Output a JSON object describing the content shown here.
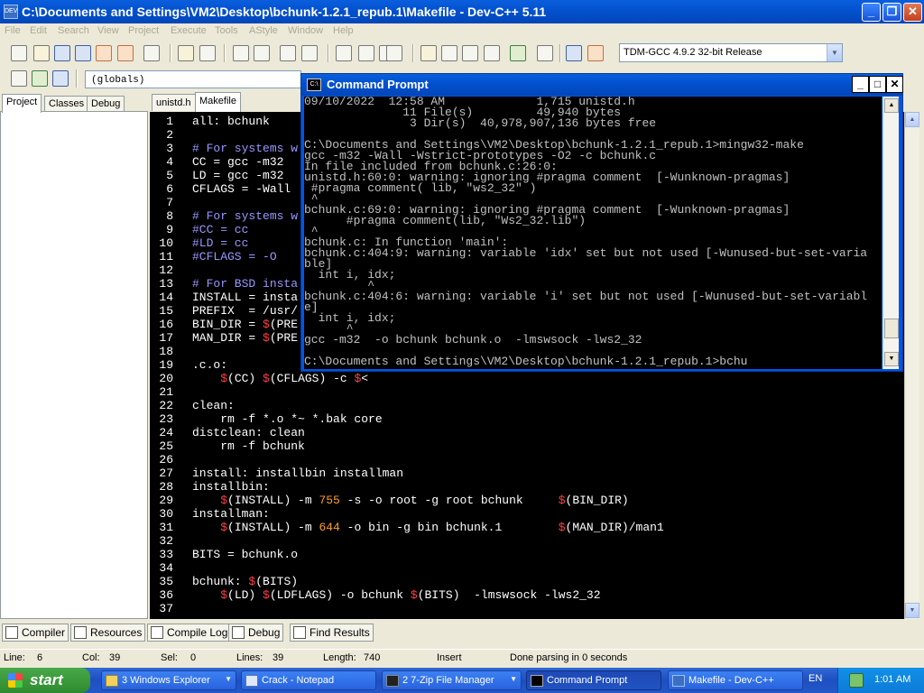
{
  "window": {
    "title": "C:\\Documents and Settings\\VM2\\Desktop\\bchunk-1.2.1_repub.1\\Makefile - Dev-C++ 5.11",
    "icon_label": "DEV",
    "minimize": "_",
    "maximize": "❐",
    "close": "✕"
  },
  "menu": [
    "File",
    "Edit",
    "Search",
    "View",
    "Project",
    "Execute",
    "Tools",
    "AStyle",
    "Window",
    "Help"
  ],
  "toolbar": {
    "compiler": "TDM-GCC 4.9.2 32-bit Release",
    "globals": "(globals)"
  },
  "left_tabs": [
    "Project",
    "Classes",
    "Debug"
  ],
  "editor_tabs": [
    "unistd.h",
    "Makefile"
  ],
  "editor": {
    "line_numbers": [
      "1",
      "2",
      "3",
      "4",
      "5",
      "6",
      "7",
      "8",
      "9",
      "10",
      "11",
      "12",
      "13",
      "14",
      "15",
      "16",
      "17",
      "18",
      "19",
      "20",
      "21",
      "22",
      "23",
      "24",
      "25",
      "26",
      "27",
      "28",
      "29",
      "30",
      "31",
      "32",
      "33",
      "34",
      "35",
      "36",
      "37"
    ],
    "lines": [
      "all: bchunk",
      "",
      "# For systems w",
      "CC = gcc -m32",
      "LD = gcc -m32",
      "CFLAGS = -Wall",
      "",
      "# For systems w",
      "#CC = cc",
      "#LD = cc",
      "#CFLAGS = -O",
      "",
      "# For BSD insta",
      "INSTALL = insta",
      "PREFIX  = /usr/",
      "BIN_DIR = $(PRE",
      "MAN_DIR = $(PRE",
      "",
      ".c.o:",
      "    $(CC) $(CFLAGS) -c $<",
      "",
      "clean:",
      "    rm -f *.o *~ *.bak core",
      "distclean: clean",
      "    rm -f bchunk",
      "",
      "install: installbin installman",
      "installbin:",
      "    $(INSTALL) -m 755 -s -o root -g root bchunk     $(BIN_DIR)",
      "installman:",
      "    $(INSTALL) -m 644 -o bin -g bin bchunk.1        $(MAN_DIR)/man1",
      "",
      "BITS = bchunk.o",
      "",
      "bchunk: $(BITS)",
      "    $(LD) $(LDFLAGS) -o bchunk $(BITS)  -lmswsock -lws2_32",
      ""
    ]
  },
  "bottom_tabs": [
    "Compiler",
    "Resources",
    "Compile Log",
    "Debug",
    "Find Results"
  ],
  "status": {
    "line_label": "Line:",
    "line_value": "6",
    "col_label": "Col:",
    "col_value": "39",
    "sel_label": "Sel:",
    "sel_value": "0",
    "lines_label": "Lines:",
    "lines_value": "39",
    "length_label": "Length:",
    "length_value": "740",
    "mode": "Insert",
    "message": "Done parsing in 0 seconds"
  },
  "cmd": {
    "title": "Command Prompt",
    "icon_label": "C:\\",
    "lines": [
      "09/10/2022  12:58 AM             1,715 unistd.h",
      "              11 File(s)         49,940 bytes",
      "               3 Dir(s)  40,978,907,136 bytes free",
      "",
      "C:\\Documents and Settings\\VM2\\Desktop\\bchunk-1.2.1_repub.1>mingw32-make",
      "gcc -m32 -Wall -Wstrict-prototypes -O2 -c bchunk.c",
      "In file included from bchunk.c:26:0:",
      "unistd.h:60:0: warning: ignoring #pragma comment  [-Wunknown-pragmas]",
      " #pragma comment( lib, \"ws2_32\" )",
      " ^",
      "bchunk.c:69:0: warning: ignoring #pragma comment  [-Wunknown-pragmas]",
      "      #pragma comment(lib, \"Ws2_32.lib\")",
      " ^",
      "bchunk.c: In function 'main':",
      "bchunk.c:404:9: warning: variable 'idx' set but not used [-Wunused-but-set-varia",
      "ble]",
      "  int i, idx;",
      "         ^",
      "bchunk.c:404:6: warning: variable 'i' set but not used [-Wunused-but-set-variabl",
      "e]",
      "  int i, idx;",
      "      ^",
      "gcc -m32  -o bchunk bchunk.o  -lmswsock -lws2_32",
      "",
      "C:\\Documents and Settings\\VM2\\Desktop\\bchunk-1.2.1_repub.1>bchu"
    ]
  },
  "taskbar": {
    "start": "start",
    "buttons": [
      {
        "label": "3 Windows Explorer",
        "arrow": "▼"
      },
      {
        "label": "Crack - Notepad",
        "arrow": ""
      },
      {
        "label": "2 7-Zip File Manager",
        "arrow": "▼"
      },
      {
        "label": "Command Prompt",
        "arrow": ""
      },
      {
        "label": "Makefile - Dev-C++",
        "arrow": ""
      }
    ],
    "lang": "EN",
    "clock": "1:01 AM"
  }
}
